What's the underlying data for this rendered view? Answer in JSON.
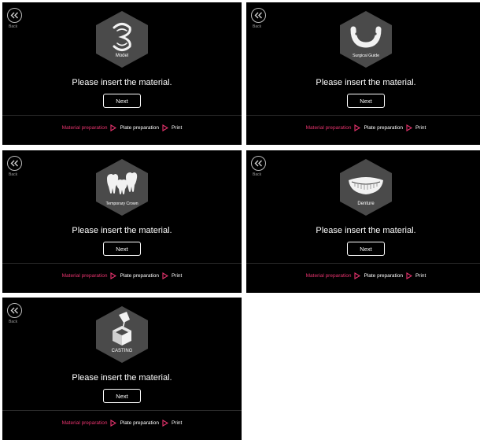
{
  "colors": {
    "background": "#000000",
    "accent": "#e8336e",
    "text": "#ffffff",
    "muted": "#9a9a9a"
  },
  "panels": [
    {
      "back_label": "Back",
      "hex_label": "Model",
      "icon": "model-icon",
      "prompt": "Please insert the material.",
      "next_label": "Next",
      "steps": [
        "Material preparation",
        "Plate preparation",
        "Print"
      ],
      "active_step": 0
    },
    {
      "back_label": "Back",
      "hex_label": "Surgical Guide",
      "icon": "surgical-guide-icon",
      "prompt": "Please insert the material.",
      "next_label": "Next",
      "steps": [
        "Material preparation",
        "Plate preparation",
        "Print"
      ],
      "active_step": 0
    },
    {
      "back_label": "Back",
      "hex_label": "Temporary Crown",
      "icon": "temporary-crown-icon",
      "prompt": "Please insert the material.",
      "next_label": "Next",
      "steps": [
        "Material preparation",
        "Plate preparation",
        "Print"
      ],
      "active_step": 0
    },
    {
      "back_label": "Back",
      "hex_label": "Denture",
      "icon": "denture-icon",
      "prompt": "Please insert the material.",
      "next_label": "Next",
      "steps": [
        "Material preparation",
        "Plate preparation",
        "Print"
      ],
      "active_step": 0
    },
    {
      "back_label": "Back",
      "hex_label": "CASTING",
      "icon": "casting-icon",
      "prompt": "Please insert the material.",
      "next_label": "Next",
      "steps": [
        "Material preparation",
        "Plate preparation",
        "Print"
      ],
      "active_step": 0
    }
  ]
}
